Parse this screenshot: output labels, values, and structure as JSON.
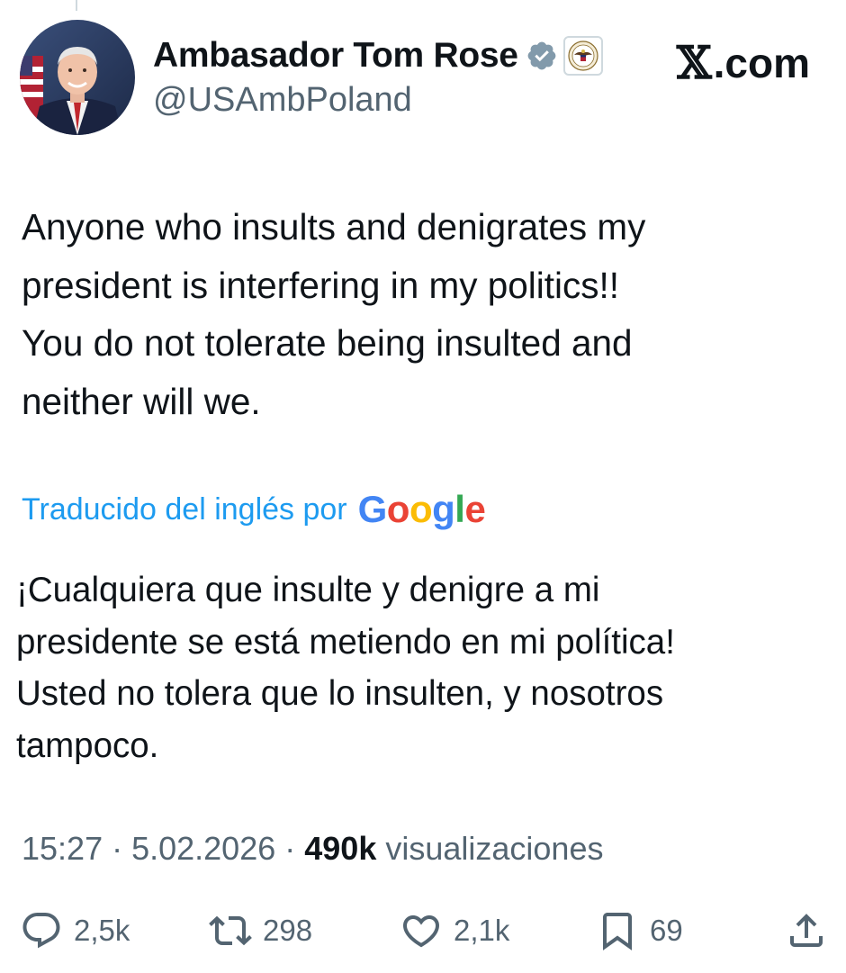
{
  "author": {
    "display_name": "Ambasador Tom Rose",
    "handle": "@USAmbPoland",
    "verified_icon": "verified-badge-icon",
    "affiliate_icon": "us-state-department-seal-icon"
  },
  "site": {
    "name": "com",
    "separator": "."
  },
  "tweet": {
    "text": "Anyone who insults and denigrates my\npresident is interfering in my politics!!\nYou do not tolerate being insulted and\nneither will we.",
    "translation_label": "Traducido del inglés por",
    "translation_provider": "Google",
    "translated_text": "¡Cualquiera que insulte y denigre a mi\npresidente se está metiendo en mi política!\nUsted no tolera que lo insulten, y nosotros\ntampoco."
  },
  "meta": {
    "time": "15:27",
    "separator": "·",
    "date": "5.02.2026",
    "views_count": "490k",
    "views_label": "visualizaciones"
  },
  "actions": {
    "replies": "2,5k",
    "reposts": "298",
    "likes": "2,1k",
    "bookmarks": "69"
  },
  "colors": {
    "link": "#1d9bf0",
    "muted": "#536471",
    "text": "#0f1419",
    "verified": "#829aab"
  }
}
